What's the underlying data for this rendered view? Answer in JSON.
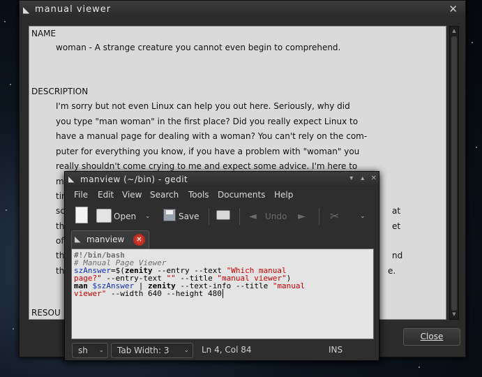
{
  "manual_viewer": {
    "title": "manual viewer",
    "sections": [
      {
        "heading": "NAME",
        "lines": [
          "woman - A strange creature you cannot even begin to comprehend."
        ]
      },
      {
        "heading": "DESCRIPTION",
        "lines": [
          "I'm  sorry but not even Linux can help you out here. Seriously, why did",
          "you type \"man woman\" in the first place? Did you really expect Linux to",
          "have a manual page for dealing with a woman? You can't rely on the com-",
          "puter for everything you know, if you have a problem with  \"woman\"  you",
          "really  shouldn't come crying to me and expect some advice. I'm here to",
          "ma",
          "tin",
          "sc",
          "th",
          "of",
          "th",
          "th"
        ]
      },
      {
        "heading": "RESOU",
        "lines": []
      }
    ],
    "partial_right": [
      "at",
      "et",
      "nd",
      "e."
    ],
    "close_label": "Close"
  },
  "gedit": {
    "title": "manview (~/bin) - gedit",
    "menu": [
      "File",
      "Edit",
      "View",
      "Search",
      "Tools",
      "Documents",
      "Help"
    ],
    "toolbar": {
      "open": "Open",
      "save": "Save",
      "undo": "Undo"
    },
    "tab_label": "manview",
    "code": {
      "line1": "#!/bin/bash",
      "line2": "# Manual Page Viewer",
      "line3_var": "szAnswer",
      "line3_op": "=$(",
      "line3_cmd": "zenity",
      "line3_args": " --entry --text ",
      "line3_str": "\"Which manual",
      "line4_str": "page?\"",
      "line4_args": " --entry-text ",
      "line4_str2": "\"\"",
      "line4_args2": " --title ",
      "line4_str3": "\"manual viewer\"",
      "line4_end": ")",
      "line5_man": "man ",
      "line5_var": "$szAnswer",
      "line5_pipe": " | ",
      "line5_cmd": "zenity",
      "line5_args": " --text-info --title ",
      "line5_str": "\"manual",
      "line6_str": "viewer\"",
      "line6_args": " --width 640 --height 480"
    },
    "status": {
      "language": "sh",
      "tab_width": "Tab Width:  3",
      "position": "Ln 4, Col 84",
      "mode": "INS"
    }
  }
}
